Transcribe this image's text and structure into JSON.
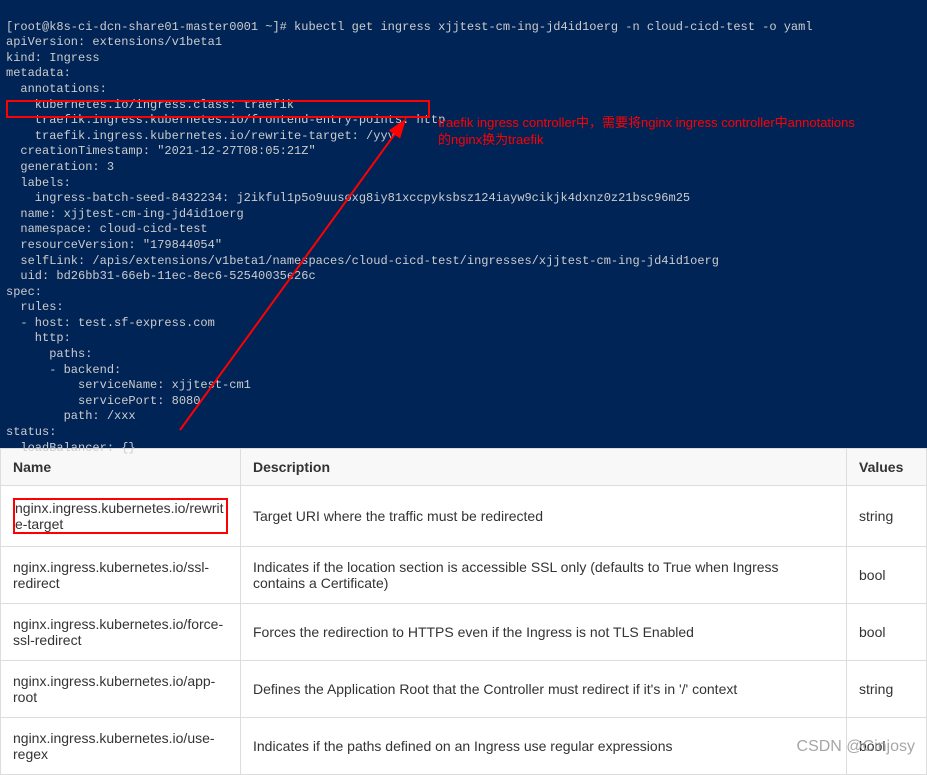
{
  "terminal": {
    "prompt": "[root@k8s-ci-dcn-share01-master0001 ~]# ",
    "command": "kubectl get ingress xjjtest-cm-ing-jd4id1oerg -n cloud-cicd-test -o yaml",
    "yaml": {
      "l1": "apiVersion: extensions/v1beta1",
      "l2": "kind: Ingress",
      "l3": "metadata:",
      "l4": "  annotations:",
      "l5": "    kubernetes.io/ingress.class: traefik",
      "l6": "    traefik.ingress.kubernetes.io/frontend-entry-points: http",
      "l7": "    traefik.ingress.kubernetes.io/rewrite-target: /yyy",
      "l8": "  creationTimestamp: \"2021-12-27T08:05:21Z\"",
      "l9": "  generation: 3",
      "l10": "  labels:",
      "l11": "    ingress-batch-seed-8432234: j2ikful1p5o9uusoxg8iy81xccpyksbsz124iayw9cikjk4dxnz0z21bsc96m25",
      "l12": "  name: xjjtest-cm-ing-jd4id1oerg",
      "l13": "  namespace: cloud-cicd-test",
      "l14": "  resourceVersion: \"179844054\"",
      "l15": "  selfLink: /apis/extensions/v1beta1/namespaces/cloud-cicd-test/ingresses/xjjtest-cm-ing-jd4id1oerg",
      "l16": "  uid: bd26bb31-66eb-11ec-8ec6-52540035e26c",
      "l17": "spec:",
      "l18": "  rules:",
      "l19": "  - host: test.sf-express.com",
      "l20": "    http:",
      "l21": "      paths:",
      "l22": "      - backend:",
      "l23": "          serviceName: xjjtest-cm1",
      "l24": "          servicePort: 8080",
      "l25": "        path: /xxx",
      "l26": "status:",
      "l27": "  loadBalancer: {}"
    },
    "annotation": "traefik ingress controller中，需要将nginx ingress controller中annotations的nginx换为traefik"
  },
  "table": {
    "headers": {
      "name": "Name",
      "description": "Description",
      "values": "Values"
    },
    "rows": [
      {
        "name": "nginx.ingress.kubernetes.io/rewrite-target",
        "description": "Target URI where the traffic must be redirected",
        "values": "string",
        "highlighted": true
      },
      {
        "name": "nginx.ingress.kubernetes.io/ssl-redirect",
        "description": "Indicates if the location section is accessible SSL only (defaults to True when Ingress contains a Certificate)",
        "values": "bool"
      },
      {
        "name": "nginx.ingress.kubernetes.io/force-ssl-redirect",
        "description": "Forces the redirection to HTTPS even if the Ingress is not TLS Enabled",
        "values": "bool"
      },
      {
        "name": "nginx.ingress.kubernetes.io/app-root",
        "description": "Defines the Application Root that the Controller must redirect if it's in '/' context",
        "values": "string"
      },
      {
        "name": "nginx.ingress.kubernetes.io/use-regex",
        "description": "Indicates if the paths defined on an Ingress use regular expressions",
        "values": "bool"
      }
    ]
  },
  "watermark": "CSDN @Cinjosy"
}
